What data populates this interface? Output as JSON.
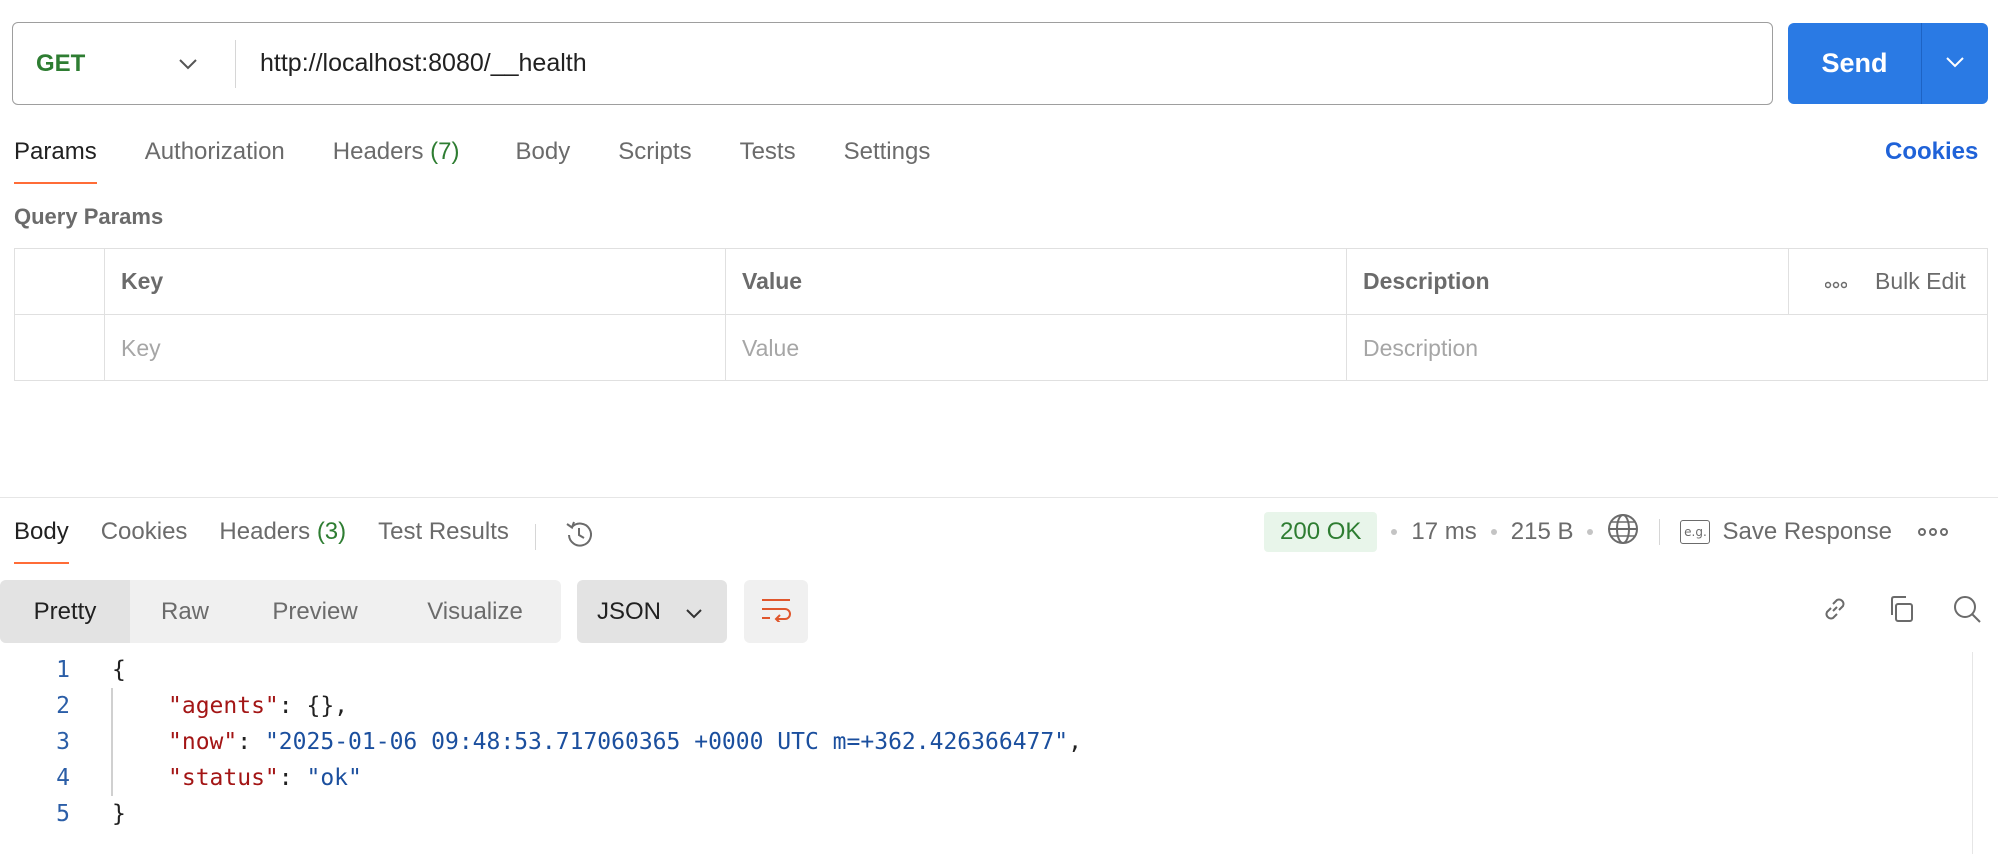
{
  "request": {
    "method": "GET",
    "url": "http://localhost:8080/__health",
    "send_label": "Send"
  },
  "request_tabs": [
    {
      "label": "Params",
      "active": true
    },
    {
      "label": "Authorization"
    },
    {
      "label": "Headers",
      "count": "(7)"
    },
    {
      "label": "Body"
    },
    {
      "label": "Scripts"
    },
    {
      "label": "Tests"
    },
    {
      "label": "Settings"
    }
  ],
  "cookies_link": "Cookies",
  "query_params": {
    "section_label": "Query Params",
    "headers": [
      "Key",
      "Value",
      "Description"
    ],
    "bulk_edit_label": "Bulk Edit",
    "placeholders": {
      "key": "Key",
      "value": "Value",
      "description": "Description"
    }
  },
  "response_tabs": [
    {
      "label": "Body",
      "active": true
    },
    {
      "label": "Cookies"
    },
    {
      "label": "Headers",
      "count": "(3)"
    },
    {
      "label": "Test Results"
    }
  ],
  "response_status": {
    "code": "200 OK",
    "time": "17 ms",
    "size": "215 B",
    "save_label": "Save Response",
    "eg_label": "e.g."
  },
  "view_modes": [
    "Pretty",
    "Raw",
    "Preview",
    "Visualize"
  ],
  "format": "JSON",
  "code_lines": [
    {
      "n": "1"
    },
    {
      "n": "2",
      "key": "\"agents\"",
      "rest": ": {},"
    },
    {
      "n": "3",
      "key": "\"now\"",
      "value": "\"2025-01-06 09:48:53.717060365 +0000 UTC m=+362.426366477\"",
      "trail": ","
    },
    {
      "n": "4",
      "key": "\"status\"",
      "value": "\"ok\""
    },
    {
      "n": "5"
    }
  ],
  "code_open": "{",
  "code_close": "}",
  "colors": {
    "accent": "#ff6c37",
    "send": "#2a7ae4",
    "method": "#2e7d32",
    "link": "#1f62d8"
  },
  "icons": [
    "chevron-down-icon",
    "history-icon",
    "globe-icon",
    "save-response-icon",
    "more-icon",
    "wrap-lines-icon",
    "link-icon",
    "copy-icon",
    "search-icon"
  ]
}
